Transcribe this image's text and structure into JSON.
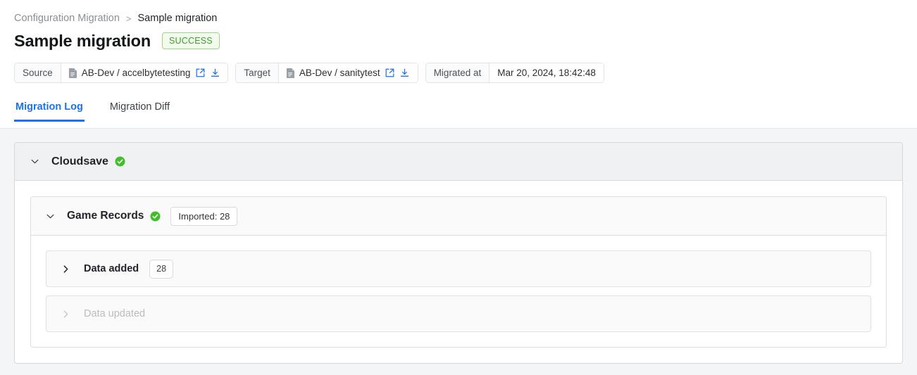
{
  "breadcrumb": {
    "parent": "Configuration Migration",
    "separator": ">",
    "current": "Sample migration"
  },
  "header": {
    "title": "Sample migration",
    "status": "SUCCESS",
    "status_color": "#3f9b2c",
    "accent_color": "#1a73e8"
  },
  "meta": {
    "source": {
      "label": "Source",
      "value": "AB-Dev / accelbytetesting",
      "file_icon": "file-icon",
      "open_icon": "external-link-icon",
      "download_icon": "download-icon"
    },
    "target": {
      "label": "Target",
      "value": "AB-Dev / sanitytest",
      "file_icon": "file-icon",
      "open_icon": "external-link-icon",
      "download_icon": "download-icon"
    },
    "migrated": {
      "label": "Migrated at",
      "value": "Mar 20, 2024, 18:42:48"
    }
  },
  "tabs": [
    {
      "label": "Migration Log",
      "active": true
    },
    {
      "label": "Migration Diff",
      "active": false
    }
  ],
  "log": {
    "service": {
      "name": "Cloudsave",
      "expanded": true,
      "chevron": "chevron-down-icon",
      "status_icon": "check-circle-icon"
    },
    "group": {
      "name": "Game Records",
      "expanded": true,
      "chevron": "chevron-down-icon",
      "status_icon": "check-circle-icon",
      "badge": "Imported: 28"
    },
    "rows": [
      {
        "name": "Data added",
        "expanded": false,
        "chevron": "chevron-right-icon",
        "count": "28",
        "disabled": false
      },
      {
        "name": "Data updated",
        "expanded": false,
        "chevron": "chevron-right-icon",
        "count": "",
        "disabled": true
      }
    ]
  }
}
